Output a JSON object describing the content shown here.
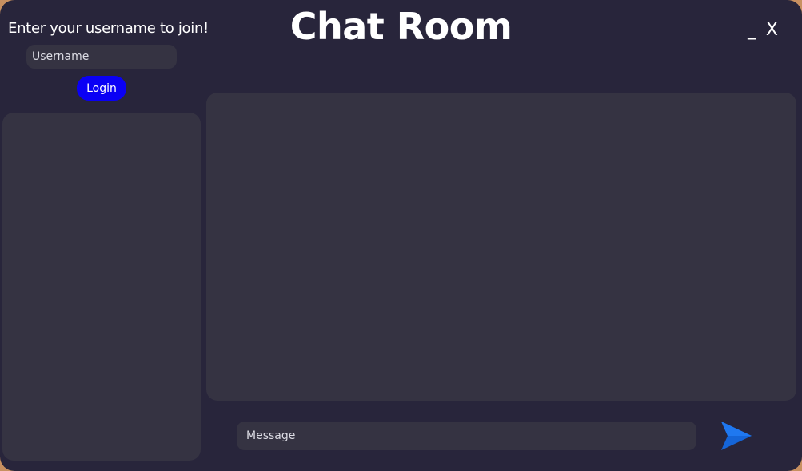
{
  "window": {
    "title": "Chat Room",
    "minimize_label": "_",
    "close_label": "X"
  },
  "login": {
    "prompt": "Enter your username to join!",
    "username_placeholder": "Username",
    "username_value": "",
    "button_label": "Login"
  },
  "users_list": {
    "items": []
  },
  "chat": {
    "messages": []
  },
  "composer": {
    "message_placeholder": "Message",
    "message_value": "",
    "send_icon": "send-arrow-icon"
  },
  "colors": {
    "window_background": "#28253b",
    "panel_background": "#353342",
    "login_button": "#0a00f5",
    "send_icon": "#1565d8",
    "text": "#ffffff"
  }
}
